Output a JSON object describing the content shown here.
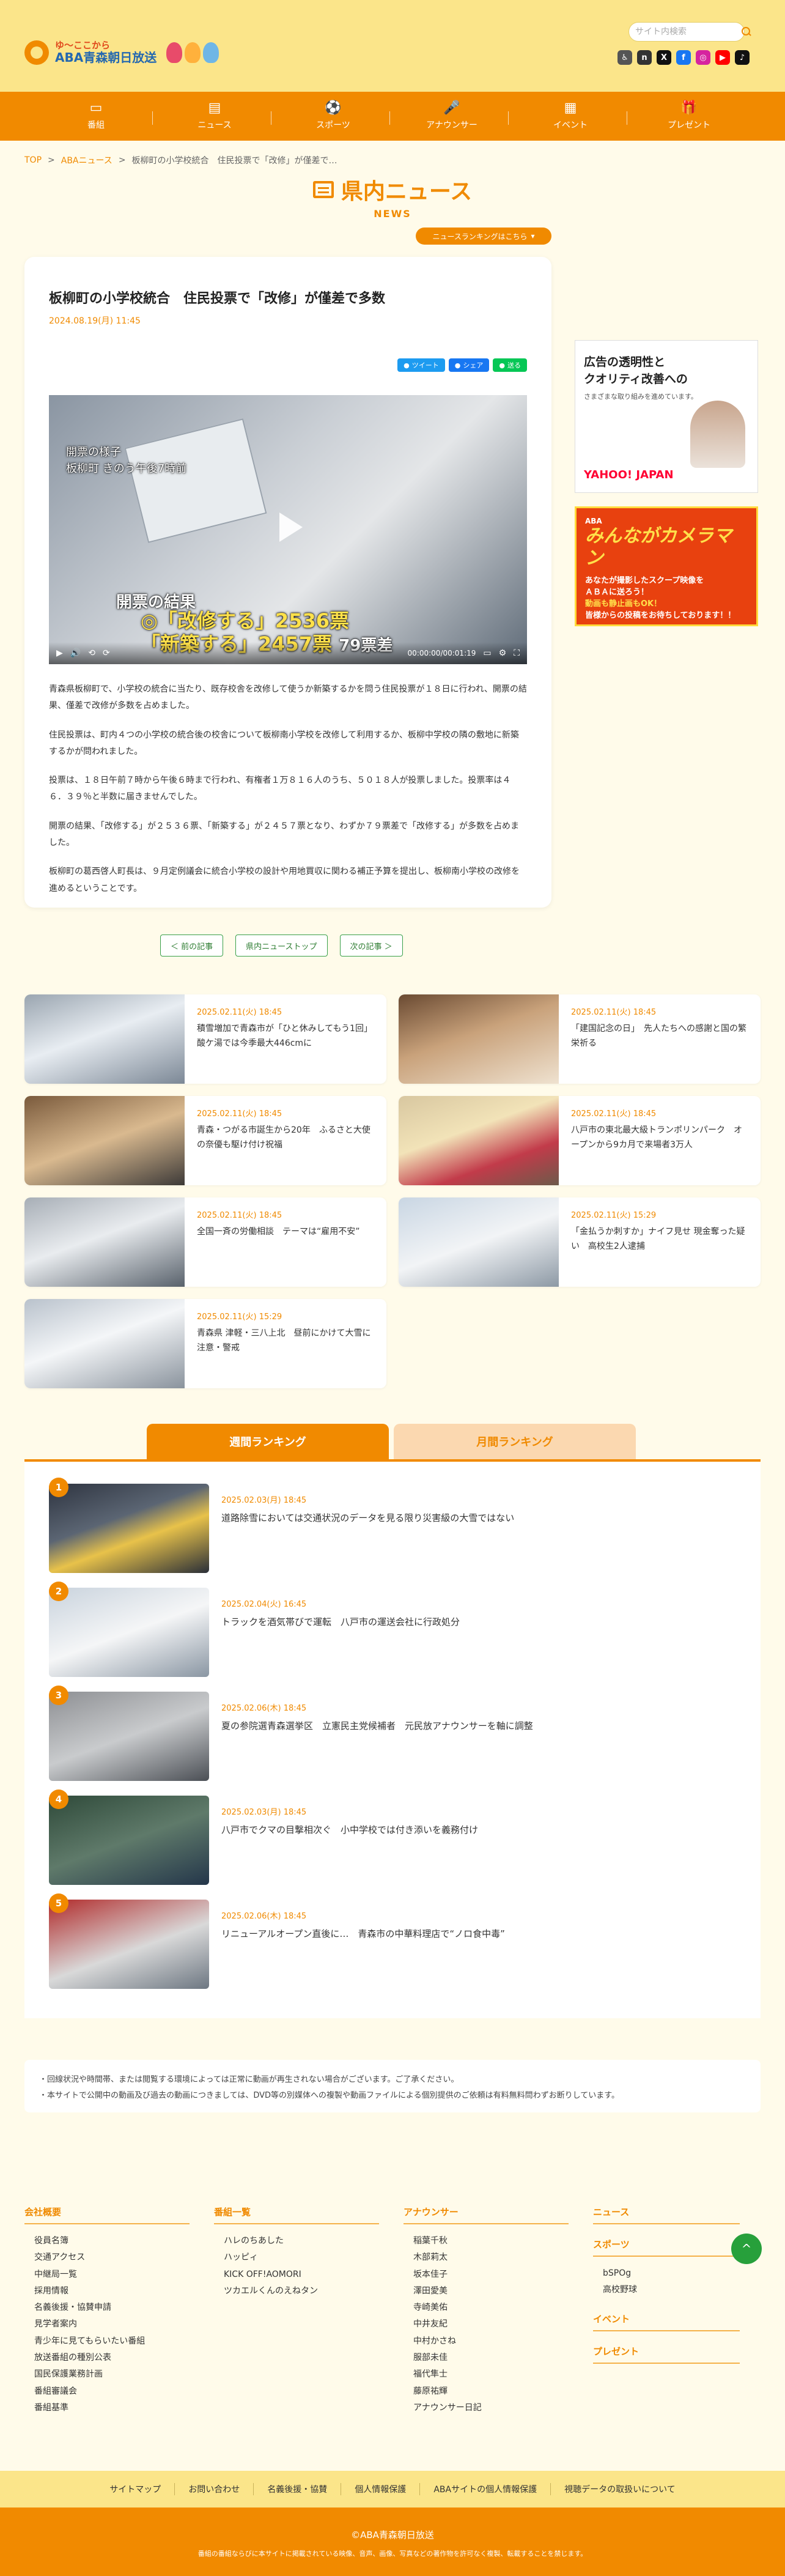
{
  "header": {
    "logo_top": "ゆ〜ここから",
    "logo_bottom": "ABA青森朝日放送",
    "search_placeholder": "サイト内検索",
    "social": [
      {
        "icon": "accessibility-icon",
        "glyph": "♿",
        "color": "#555555"
      },
      {
        "icon": "note-icon",
        "glyph": "n",
        "color": "#333333"
      },
      {
        "icon": "x-icon",
        "glyph": "X",
        "color": "#111111"
      },
      {
        "icon": "facebook-icon",
        "glyph": "f",
        "color": "#1877f2"
      },
      {
        "icon": "instagram-icon",
        "glyph": "◎",
        "color": "#d6249f"
      },
      {
        "icon": "youtube-icon",
        "glyph": "▶",
        "color": "#ff0000"
      },
      {
        "icon": "tiktok-icon",
        "glyph": "♪",
        "color": "#111111"
      }
    ]
  },
  "nav": [
    {
      "label": "番組",
      "glyph": "▭",
      "icon": "tv-icon"
    },
    {
      "label": "ニュース",
      "glyph": "▤",
      "icon": "news-icon"
    },
    {
      "label": "スポーツ",
      "glyph": "⚽",
      "icon": "soccer-ball-icon"
    },
    {
      "label": "アナウンサー",
      "glyph": "🎤",
      "icon": "microphone-icon"
    },
    {
      "label": "イベント",
      "glyph": "▦",
      "icon": "calendar-icon"
    },
    {
      "label": "プレゼント",
      "glyph": "🎁",
      "icon": "gift-icon"
    }
  ],
  "breadcrumb": {
    "top": "TOP",
    "section": "ABAニュース",
    "current": "板柳町の小学校統合　住民投票で「改修」が僅差で…",
    "sep": ">"
  },
  "section": {
    "title_jp": "県内ニュース",
    "title_en": "NEWS"
  },
  "ranking_link": "ニュースランキングはこちら",
  "article": {
    "title": "板柳町の小学校統合　住民投票で「改修」が僅差で多数",
    "date": "2024.08.19(月) 11:45",
    "share": [
      {
        "label": "ツイート",
        "color": "#1d9bf0",
        "icon": "twitter-icon"
      },
      {
        "label": "シェア",
        "color": "#1877f2",
        "icon": "facebook-share-icon"
      },
      {
        "label": "送る",
        "color": "#06c755",
        "icon": "line-icon"
      }
    ],
    "video": {
      "caption_line1": "開票の様子",
      "caption_line2": "板柳町 きのう午後7時前",
      "result_title": "開票の結果",
      "result_1": "◎「改修する」2536票",
      "result_2": "「新築する」2457票",
      "result_diff": "79票差",
      "time": "00:00:00/00:01:19"
    },
    "paragraphs": [
      "青森県板柳町で、小学校の統合に当たり、既存校舎を改修して使うか新築するかを問う住民投票が１８日に行われ、開票の結果、僅差で改修が多数を占めました。",
      "住民投票は、町内４つの小学校の統合後の校舎について板柳南小学校を改修して利用するか、板柳中学校の隣の敷地に新築するかが問われました。",
      "投票は、１８日午前７時から午後６時まで行われ、有権者１万８１６人のうち、５０１８人が投票しました。投票率は４６．３９％と半数に届きませんでした。",
      "開票の結果、「改修する」が２５３６票、「新築する」が２４５７票となり、わずか７９票差で「改修する」が多数を占めました。",
      "板柳町の葛西啓人町長は、９月定例議会に統合小学校の設計や用地買収に関わる補正予算を提出し、板柳南小学校の改修を進めるということです。"
    ]
  },
  "ads": {
    "ad1_title_1": "広告の透明性と",
    "ad1_title_2": "クオリティ改善への",
    "ad1_sub": "さまざまな取り組みを進めています。",
    "ad1_logo": "YAHOO! JAPAN",
    "ad2_title": "みんながカメラマン",
    "ad2_brand": "ABA",
    "ad2_line1": "あなたが撮影したスクープ映像を",
    "ad2_line2": "ＡＢＡに送ろう！",
    "ad2_line3": "動画も静止画もOK！",
    "ad2_line4": "皆様からの投稿をお待ちしております！！"
  },
  "pager": {
    "prev": "＜ 前の記事",
    "list": "県内ニューストップ",
    "next": "次の記事 ＞"
  },
  "related": [
    {
      "date": "2025.02.11(火) 18:45",
      "title": "積雪増加で青森市が「ひと休みしてもう1回」　酸ケ湯では今季最大446cmに",
      "thumb": "linear-gradient(160deg,#9aa5b0 0%,#e8edf2 45%,#7c8896 100%)"
    },
    {
      "date": "2025.02.11(火) 18:45",
      "title": "「建国記念の日」　先人たちへの感謝と国の繁栄祈る",
      "thumb": "linear-gradient(160deg,#6a4a32 0%,#c9a27b 45%,#efe2d0 100%)"
    },
    {
      "date": "2025.02.11(火) 18:45",
      "title": "青森・つがる市誕生から20年　ふるさと大使の奈優も駆け付け祝福",
      "thumb": "linear-gradient(160deg,#7a5a3c 0%,#d9b98f 50%,#3d3a38 100%)"
    },
    {
      "date": "2025.02.11(火) 18:45",
      "title": "八戸市の東北最大級トランポリンパーク　オープンから9カ月で来場者3万人",
      "thumb": "linear-gradient(160deg,#d8c7a0 0%,#f2e3b8 40%,#c23b4a 70%,#6d5a4a 100%)"
    },
    {
      "date": "2025.02.11(火) 18:45",
      "title": "全国一斉の労働相談　テーマは“雇用不安”",
      "thumb": "linear-gradient(160deg,#a7aeb6 0%,#e9ecef 45%,#59626c 100%)"
    },
    {
      "date": "2025.02.11(火) 15:29",
      "title": "「金払うか刺すか」ナイフ見せ 現金奪った疑い　高校生2人逮捕",
      "thumb": "linear-gradient(160deg,#c9d6e3 0%,#f2f4f6 50%,#8d99a5 100%)"
    },
    {
      "date": "2025.02.11(火) 15:29",
      "title": "青森県 津軽・三八上北　昼前にかけて大雪に注意・警戒",
      "thumb": "linear-gradient(160deg,#b9c2cc 0%,#f4f6f8 45%,#8a939d 100%)"
    }
  ],
  "ranking": {
    "tab_weekly": "週間ランキング",
    "tab_monthly": "月間ランキング",
    "items": [
      {
        "num": "1",
        "date": "2025.02.03(月) 18:45",
        "title": "道路除雪においては交通状況のデータを見る限り災害級の大雪ではない",
        "thumb": "linear-gradient(160deg,#2e3440 0%,#5b6573 40%,#e8c24a 60%,#2a2f38 100%)"
      },
      {
        "num": "2",
        "date": "2025.02.04(火) 16:45",
        "title": "トラックを酒気帯びで運転　八戸市の運送会社に行政処分",
        "thumb": "linear-gradient(160deg,#c9d3dd 0%,#f5f6f7 50%,#8a96a3 100%)"
      },
      {
        "num": "3",
        "date": "2025.02.06(木) 18:45",
        "title": "夏の参院選青森選挙区　立憲民主党候補者　元民放アナウンサーを軸に調整",
        "thumb": "linear-gradient(160deg,#8d8f93 0%,#c9cbcd 50%,#4b4f55 100%)"
      },
      {
        "num": "4",
        "date": "2025.02.03(月) 18:45",
        "title": "八戸市でクマの目撃相次ぐ　小中学校では付き添いを義務付け",
        "thumb": "linear-gradient(160deg,#2f4a3a 0%,#5f7a6a 50%,#24364a 100%)"
      },
      {
        "num": "5",
        "date": "2025.02.06(木) 18:45",
        "title": "リニューアルオープン直後に…　青森市の中華料理店で“ノロ食中毒”",
        "thumb": "linear-gradient(160deg,#b12a2a 0%,#d9d9d9 55%,#6d7782 100%)"
      }
    ]
  },
  "notes": [
    "・回線状況や時間帯、または閲覧する環境によっては正常に動画が再生されない場合がございます。ご了承ください。",
    "・本サイトで公開中の動画及び過去の動画につきましては、DVD等の別媒体への複製や動画ファイルによる個別提供のご依頼は有料無料問わずお断りしています。"
  ],
  "footer": {
    "col1": {
      "head": "会社概要",
      "items": [
        "役員名簿",
        "交通アクセス",
        "中継局一覧",
        "採用情報",
        "名義後援・協賛申請",
        "見学者案内",
        "青少年に見てもらいたい番組",
        "放送番組の種別公表",
        "国民保護業務計画",
        "番組審議会",
        "番組基準"
      ]
    },
    "col2": {
      "head": "番組一覧",
      "items": [
        "ハレのちあした",
        "ハッピィ",
        "KICK OFF!AOMORI",
        "ツカエルくんのえねタン"
      ]
    },
    "col3": {
      "head": "アナウンサー",
      "items": [
        "稲葉千秋",
        "木部莉太",
        "坂本佳子",
        "澤田愛美",
        "寺崎美佑",
        "中井友紀",
        "中村かさね",
        "服部未佳",
        "福代隼士",
        "藤原祐輝",
        "アナウンサー日記"
      ]
    },
    "col4": {
      "head": "ニュース",
      "sports_head": "スポーツ",
      "sports_items": [
        "bSPOg",
        "高校野球"
      ],
      "event_head": "イベント",
      "present_head": "プレゼント"
    }
  },
  "page_top": "^",
  "bottom_links": [
    "サイトマップ",
    "お問い合わせ",
    "名義後援・協賛",
    "個人情報保護",
    "ABAサイトの個人情報保護",
    "視聴データの取扱いについて"
  ],
  "copyright": {
    "line1": "©ABA青森朝日放送",
    "line2": "番組の番組ならびに本サイトに掲載されている映像、音声、画像、写真などの著作物を許可なく複製、転載することを禁じます。"
  }
}
